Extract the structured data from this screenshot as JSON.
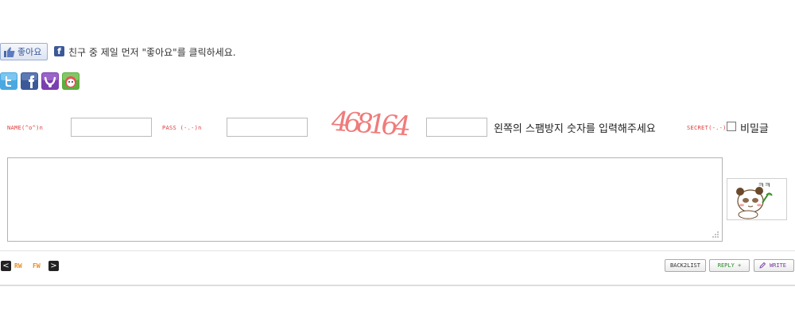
{
  "like": {
    "button_label": "좋아요",
    "fb_letter": "f",
    "text": "친구 중 제일 먼저 \"좋아요\"를 클릭하세요."
  },
  "share": {
    "icons": [
      "twitter-icon",
      "facebook-icon",
      "yozm-icon",
      "me2day-icon"
    ]
  },
  "form": {
    "name_label": "NAME(^o^)n",
    "pass_label": "PASS (-.-)n",
    "captcha": "468164",
    "spam_hint": "왼쪽의 스팸방지 숫자를 입력해주세요",
    "secret_label": "SECRET(-.-)n",
    "secret_text": "비밀글",
    "name_value": "",
    "pass_value": "",
    "captcha_value": "",
    "comment_value": ""
  },
  "nav": {
    "prev_glyph": "<",
    "next_glyph": ">",
    "rw": "RW",
    "fw": "FW"
  },
  "buttons": {
    "backlist": "BACK2LIST",
    "reply": "REPLY +",
    "write": "WRITE"
  },
  "colors": {
    "label_red": "#e03a3a",
    "captcha_pink": "#f07b7b",
    "nav_orange": "#f08a1a",
    "reply_green": "#2a8a2a",
    "write_purple": "#7a3aa0",
    "facebook_blue": "#3b5998"
  }
}
